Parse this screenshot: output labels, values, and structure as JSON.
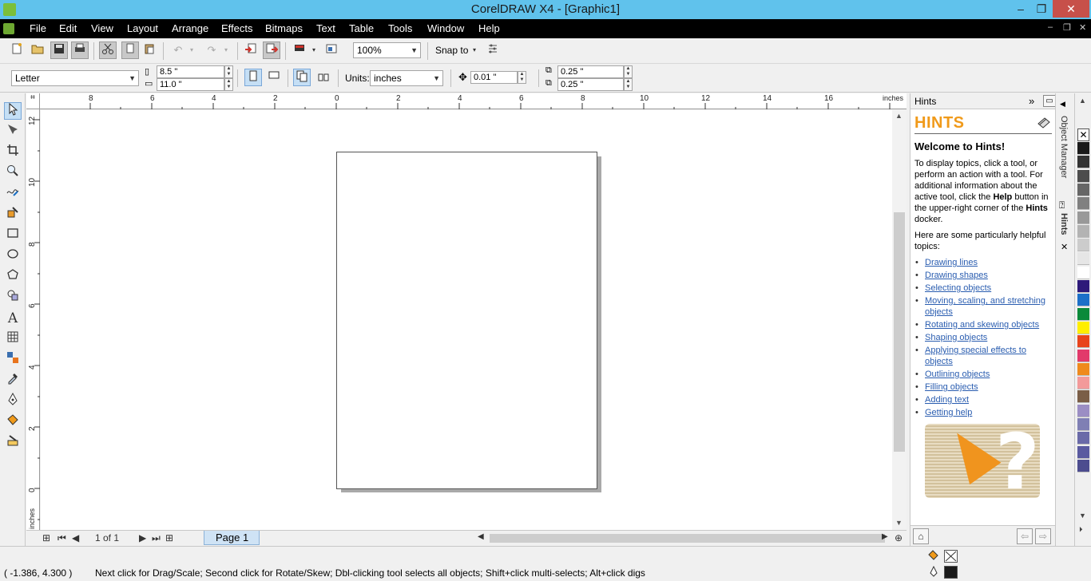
{
  "window": {
    "title": "CorelDRAW X4 - [Graphic1]",
    "minimize_glyph": "–",
    "restore_glyph": "❐",
    "close_glyph": "✕"
  },
  "menu": {
    "items": [
      "File",
      "Edit",
      "View",
      "Layout",
      "Arrange",
      "Effects",
      "Bitmaps",
      "Text",
      "Table",
      "Tools",
      "Window",
      "Help"
    ],
    "mdi_min": "–",
    "mdi_restore": "❐",
    "mdi_close": "✕"
  },
  "standard_toolbar": {
    "zoom_level": "100%",
    "snap_to_label": "Snap to"
  },
  "property_bar": {
    "paper_size": "Letter",
    "page_width": "8.5 \"",
    "page_height": "11.0 \"",
    "units_label": "Units:",
    "units_value": "inches",
    "nudge": "0.01 \"",
    "duplicate_x": "0.25 \"",
    "duplicate_y": "0.25 \""
  },
  "rulers": {
    "top_labels": [
      "8",
      "6",
      "4",
      "2",
      "0",
      "2",
      "4",
      "6",
      "8",
      "10",
      "12",
      "14",
      "16"
    ],
    "top_unit": "inches",
    "left_labels": [
      "12",
      "10",
      "8",
      "6",
      "4",
      "2",
      "0"
    ],
    "left_unit": "inches"
  },
  "navigator": {
    "page_count": "1 of 1",
    "page_tab": "Page 1"
  },
  "hints_docker": {
    "header": "Hints",
    "logo": "HINTS",
    "welcome": "Welcome to Hints!",
    "intro_part1": "To display topics, click a tool, or perform an action with a tool. For additional information about the active tool, click the ",
    "intro_bold1": "Help",
    "intro_part2": " button in the upper-right corner of the ",
    "intro_bold2": "Hints",
    "intro_part3": " docker.",
    "helpful_intro": "Here are some particularly helpful topics:",
    "topics": [
      "Drawing lines",
      "Drawing shapes",
      "Selecting objects",
      "Moving, scaling, and stretching objects",
      "Rotating and skewing objects",
      "Shaping objects",
      "Applying special effects to objects",
      "Outlining objects",
      "Filling objects",
      "Adding text",
      "Getting help"
    ],
    "link_color": "#2a5db0",
    "logo_color": "#f09a1a"
  },
  "docker_tabs": {
    "object_manager": "Object Manager",
    "hints": "Hints"
  },
  "palette": {
    "colors": [
      "#1a1a1a",
      "#333333",
      "#4d4d4d",
      "#666666",
      "#808080",
      "#999999",
      "#b3b3b3",
      "#cccccc",
      "#e6e6e6",
      "#ffffff",
      "#2e1a7a",
      "#1c70c8",
      "#0b8a3a",
      "#ffee00",
      "#e8431b",
      "#e23a6b",
      "#ef8a1d",
      "#f39a9a",
      "#7a5e47",
      "#9b8ec4",
      "#7f7fb4",
      "#6a6aa8",
      "#5a5aa0",
      "#4d4d8f"
    ]
  },
  "status": {
    "coords": "( -1.386, 4.300  )",
    "message": "Next click for Drag/Scale; Second click for Rotate/Skew; Dbl-clicking tool selects all objects; Shift+click multi-selects; Alt+click digs"
  }
}
